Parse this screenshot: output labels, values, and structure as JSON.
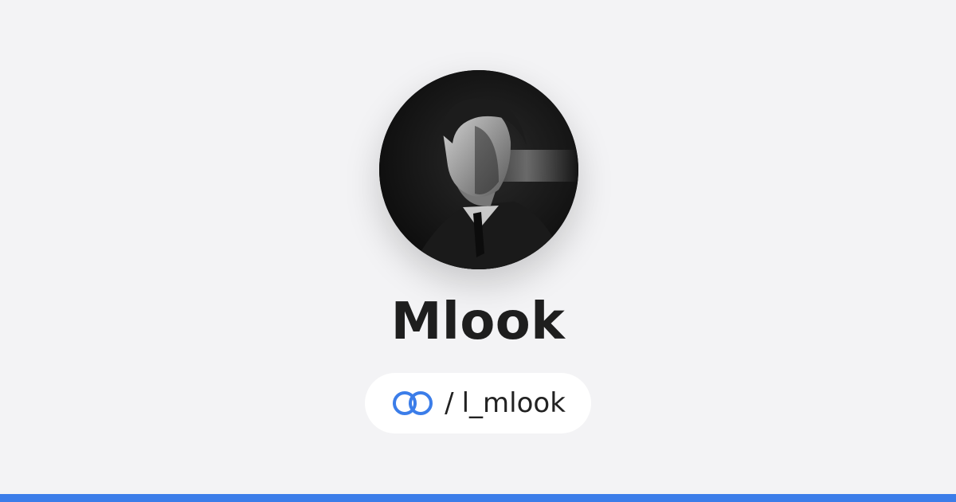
{
  "profile": {
    "name": "Mlook",
    "handle_separator": "/",
    "handle": "l_mlook",
    "avatar_icon": "profile-photo"
  },
  "icons": {
    "link": "link-rings-icon"
  },
  "colors": {
    "background": "#f3f3f5",
    "accent": "#3b7de9",
    "pill": "#ffffff",
    "text": "#1e1e1e"
  }
}
